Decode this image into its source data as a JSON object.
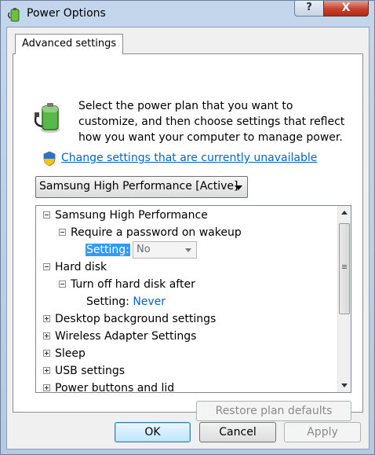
{
  "window": {
    "title": "Power Options",
    "help_label": "?",
    "close_label": "X"
  },
  "tab": {
    "label": "Advanced settings"
  },
  "intro": {
    "text": "Select the power plan that you want to customize, and then choose settings that reflect how you want your computer to manage power."
  },
  "link": {
    "text": "Change settings that are currently unavailable"
  },
  "plan_select": {
    "value": "Samsung High Performance [Active]"
  },
  "tree": {
    "plan_label": "Samsung High Performance",
    "require_password_label": "Require a password on wakeup",
    "require_password_setting_label": "Setting:",
    "require_password_setting_value": "No",
    "hard_disk_label": "Hard disk",
    "turn_off_disk_label": "Turn off hard disk after",
    "turn_off_disk_setting_label": "Setting:",
    "turn_off_disk_setting_value": "Never",
    "desktop_bg_label": "Desktop background settings",
    "wireless_label": "Wireless Adapter Settings",
    "sleep_label": "Sleep",
    "usb_label": "USB settings",
    "power_buttons_label": "Power buttons and lid"
  },
  "buttons": {
    "restore": "Restore plan defaults",
    "ok": "OK",
    "cancel": "Cancel",
    "apply": "Apply"
  },
  "colors": {
    "link": "#0066cc",
    "selection": "#3399ff",
    "close_button": "#c8402a"
  },
  "icons": [
    "battery-plug-icon",
    "uac-shield-icon",
    "help-icon",
    "close-icon"
  ]
}
